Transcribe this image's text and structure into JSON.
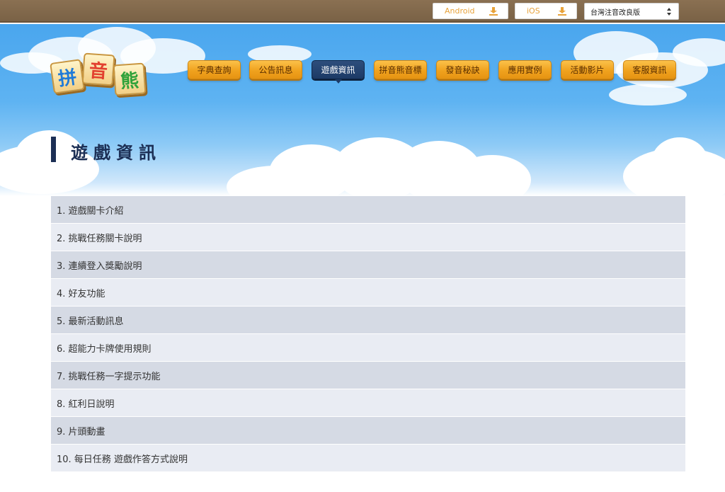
{
  "topbar": {
    "android_label": "Android",
    "ios_label": "iOS",
    "version_select": "台灣注音改良版"
  },
  "logo": {
    "chars": [
      "拼",
      "音",
      "熊"
    ]
  },
  "nav": [
    {
      "label": "字典查詢"
    },
    {
      "label": "公告訊息"
    },
    {
      "label": "遊戲資訊",
      "active": true
    },
    {
      "label": "拼音熊音標"
    },
    {
      "label": "發音秘訣"
    },
    {
      "label": "應用實例"
    },
    {
      "label": "活動影片"
    },
    {
      "label": "客服資訊"
    }
  ],
  "page_title": "遊戲資訊",
  "items": [
    "1. 遊戲關卡介紹",
    "2. 挑戰任務關卡說明",
    "3. 連續登入獎勵說明",
    "4. 好友功能",
    "5. 最新活動訊息",
    "6. 超能力卡牌使用規則",
    "7. 挑戰任務一字提示功能",
    "8. 紅利日說明",
    "9. 片頭動畫",
    "10. 每日任務 遊戲作答方式說明"
  ],
  "colors": {
    "nav_orange": "#f0a21e",
    "nav_active": "#1c3a66",
    "title": "#1c2f55",
    "sky": "#4aa6ee"
  }
}
